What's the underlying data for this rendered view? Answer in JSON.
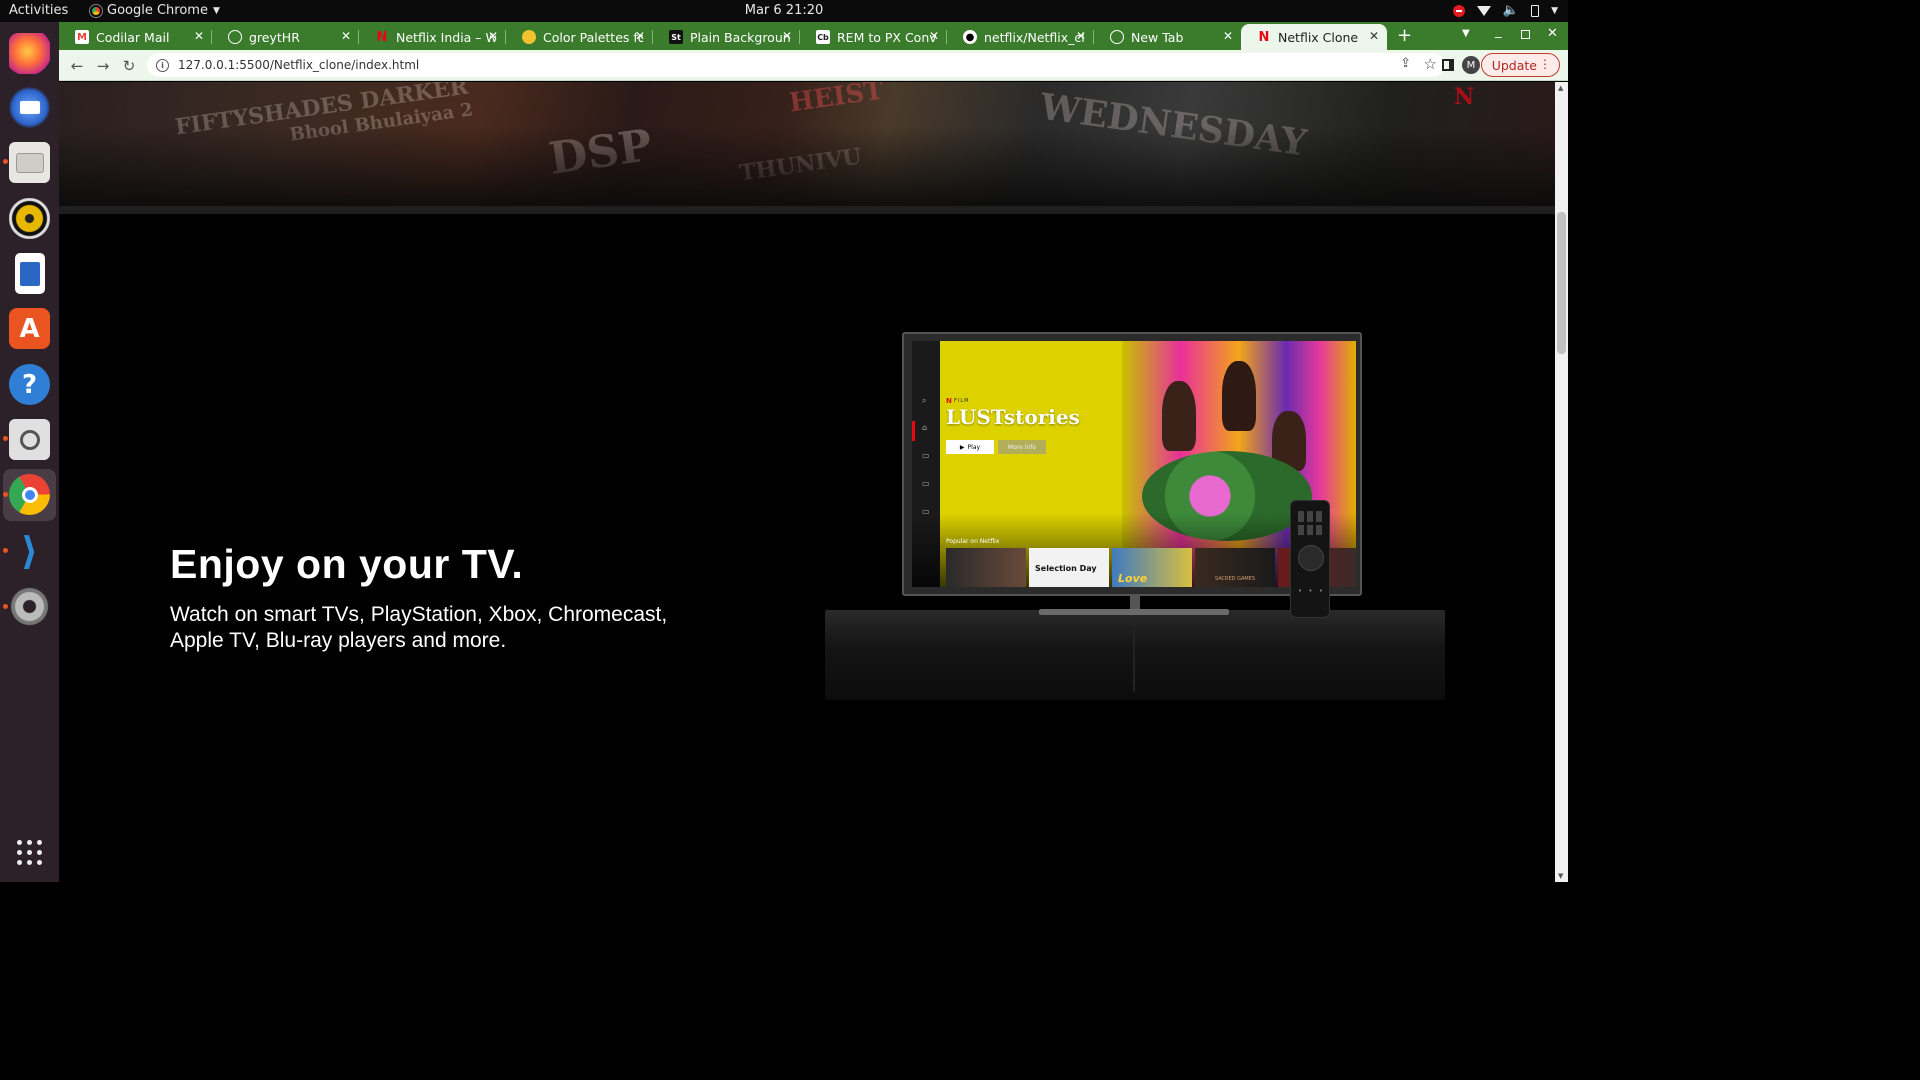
{
  "system_bar": {
    "activities": "Activities",
    "app_name": "Google Chrome",
    "clock": "Mar 6  21:20"
  },
  "browser": {
    "tabs": [
      {
        "title": "Codilar Mail",
        "favicon": "gmail-icon",
        "active": false
      },
      {
        "title": "greytHR",
        "favicon": "globe-icon",
        "active": false
      },
      {
        "title": "Netflix India – Wa",
        "favicon": "netflix-icon",
        "active": false
      },
      {
        "title": "Color Palettes fo",
        "favicon": "palette-icon",
        "active": false
      },
      {
        "title": "Plain Backgroun",
        "favicon": "st-icon",
        "active": false
      },
      {
        "title": "REM to PX Conve",
        "favicon": "cb-icon",
        "active": false
      },
      {
        "title": "netflix/Netflix_cl",
        "favicon": "github-icon",
        "active": false
      },
      {
        "title": "New Tab",
        "favicon": "globe-icon",
        "active": false
      },
      {
        "title": "Netflix Clone",
        "favicon": "netflix-icon",
        "active": true
      }
    ],
    "url": "127.0.0.1:5500/Netflix_clone/index.html",
    "update_label": "Update",
    "profile_initial": "M",
    "accent_color": "#3a7c2c"
  },
  "page": {
    "feature": {
      "title": "Enjoy on your TV.",
      "subtitle": "Watch on smart TVs, PlayStation, Xbox, Chromecast, Apple TV, Blu-ray players and more."
    },
    "tv_screen": {
      "tag": "FILM",
      "show_title": "LUSTstories",
      "play_label": "Play",
      "more_info_label": "More Info",
      "row_title": "Popular on Netflix",
      "thumbnails": [
        "",
        "Selection Day",
        "Love",
        "SACRED GAMES",
        ""
      ]
    }
  }
}
